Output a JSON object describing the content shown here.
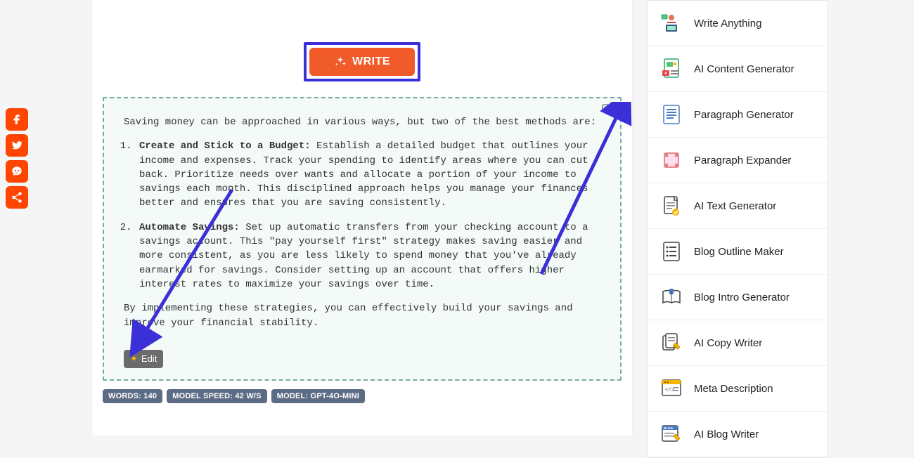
{
  "write_button_label": "WRITE",
  "output": {
    "intro": "Saving money can be approached in various ways, but two of the best methods are:",
    "items": [
      {
        "title": "Create and Stick to a Budget",
        "body": "Establish a detailed budget that outlines your income and expenses. Track your spending to identify areas where you can cut back. Prioritize needs over wants and allocate a portion of your income to savings each month. This disciplined approach helps you manage your finances better and ensures that you are saving consistently."
      },
      {
        "title": "Automate Savings",
        "body": "Set up automatic transfers from your checking account to a savings account. This \"pay yourself first\" strategy makes saving easier and more consistent, as you are less likely to spend money that you've already earmarked for savings. Consider setting up an account that offers higher interest rates to maximize your savings over time."
      }
    ],
    "conclusion": "By implementing these strategies, you can effectively build your savings and improve your financial stability."
  },
  "edit_label": "Edit",
  "badges": {
    "words": "WORDS: 140",
    "speed": "MODEL SPEED: 42 W/S",
    "model": "MODEL: GPT-4O-MINI"
  },
  "sidebar": {
    "items": [
      {
        "label": "Write Anything"
      },
      {
        "label": "AI Content Generator"
      },
      {
        "label": "Paragraph Generator"
      },
      {
        "label": "Paragraph Expander"
      },
      {
        "label": "AI Text Generator"
      },
      {
        "label": "Blog Outline Maker"
      },
      {
        "label": "Blog Intro Generator"
      },
      {
        "label": "AI Copy Writer"
      },
      {
        "label": "Meta Description"
      },
      {
        "label": "AI Blog Writer"
      }
    ]
  }
}
